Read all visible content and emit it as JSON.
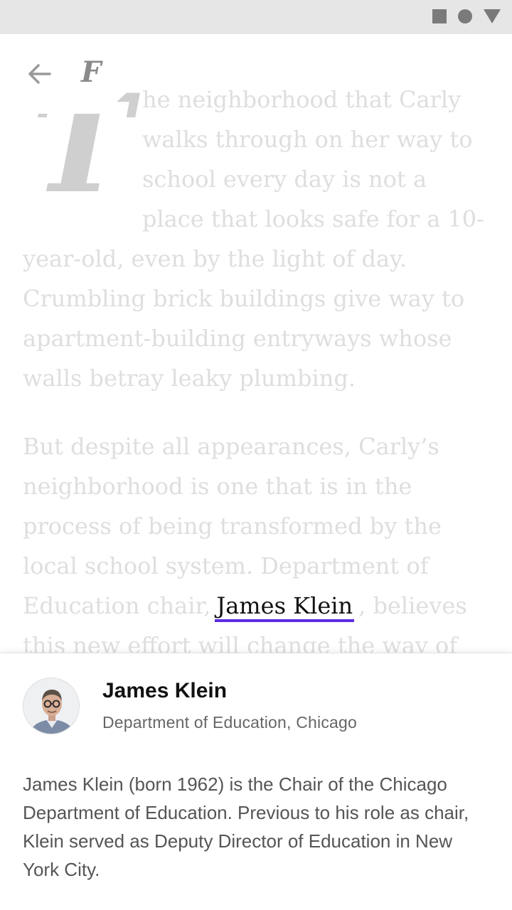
{
  "status_bar": {
    "icons": [
      "square-icon",
      "circle-icon",
      "triangle-icon"
    ],
    "background": "#e6e6e6"
  },
  "toolbar": {
    "back_icon": "arrow-left-icon",
    "logo_glyph": "F"
  },
  "article": {
    "drop_cap": "T",
    "paragraph1": "he neighborhood that Carly walks through on her way to school every day is not a place that looks safe for a 10-year-old, even by the light of day. Crumbling brick buildings give way to apartment-building entryways whose walls betray leaky plumbing.",
    "paragraph2_before": "But despite all appearances, Carly’s neighborhood is one that is in the process of being transformed by the local school system. Department of Education chair,",
    "person_link": "James Klein",
    "paragraph2_after": ", believes this new effort will change the way of"
  },
  "card": {
    "name": "James Klein",
    "organization": "Department of Education, Chicago",
    "bio": "James Klein (born 1962) is the Chair of the Chicago Department of Education. Previous to his role as chair, Klein served as Deputy Director of Education in New York City."
  },
  "colors": {
    "link_underline": "#5c2be2",
    "faded_text": "#dedede"
  }
}
